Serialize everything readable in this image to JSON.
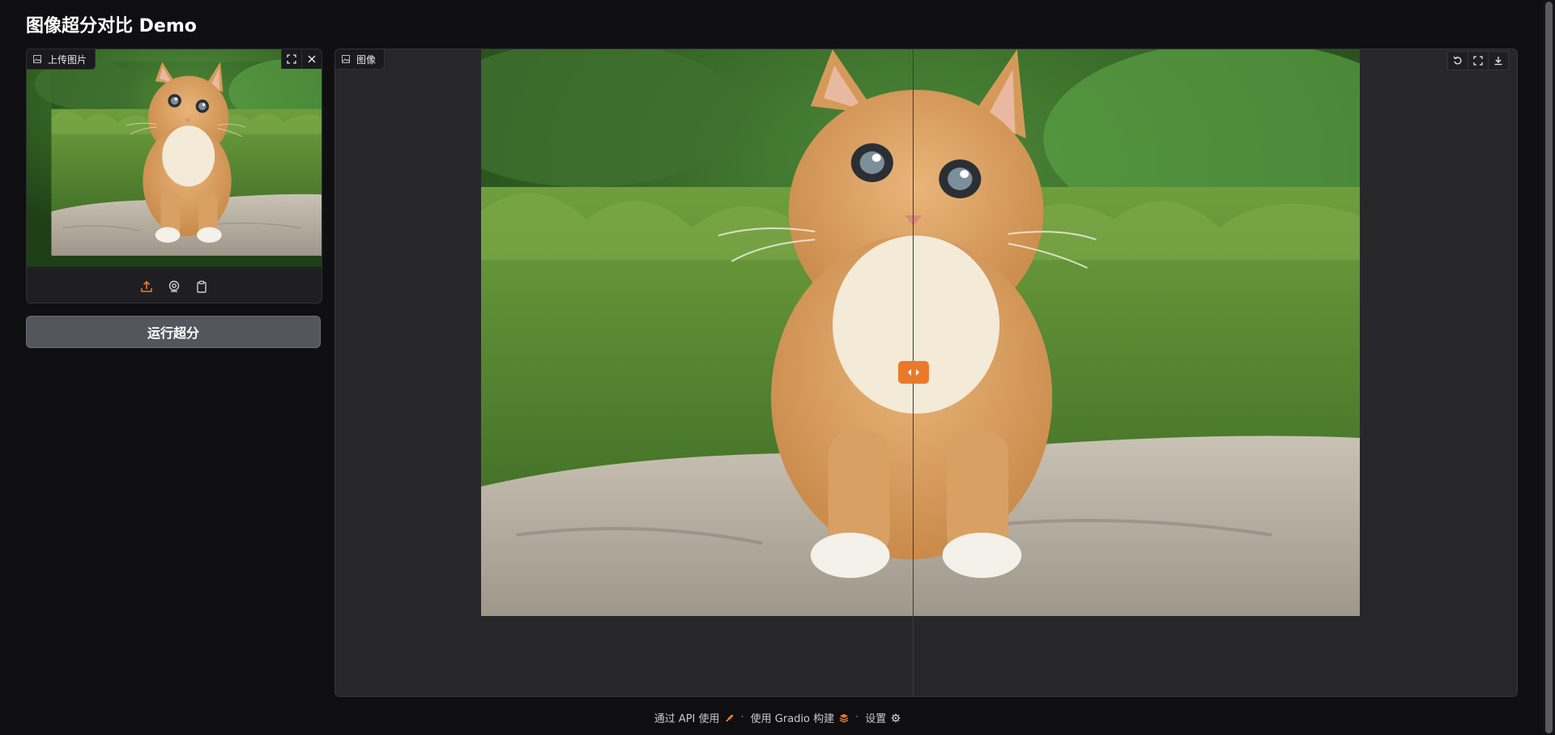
{
  "app": {
    "title": "图像超分对比 Demo"
  },
  "upload": {
    "label": "上传图片",
    "toolbar": {
      "fullscreen_icon": "fullscreen-icon",
      "clear_icon": "close-icon"
    },
    "sources": [
      "upload-icon",
      "webcam-icon",
      "clipboard-icon"
    ]
  },
  "run_button": {
    "label": "运行超分"
  },
  "compare": {
    "label": "图像",
    "toolbar": [
      "undo-icon",
      "fullscreen-icon",
      "download-icon"
    ],
    "slider_position": 0.49
  },
  "footer": {
    "api": "通过 API 使用",
    "built_with": "使用 Gradio 构建",
    "settings": "设置",
    "separator": "·"
  },
  "colors": {
    "background": "#0f0f11",
    "panel": "#27272a",
    "accent": "#ea7a2a",
    "button": "#55555d"
  }
}
